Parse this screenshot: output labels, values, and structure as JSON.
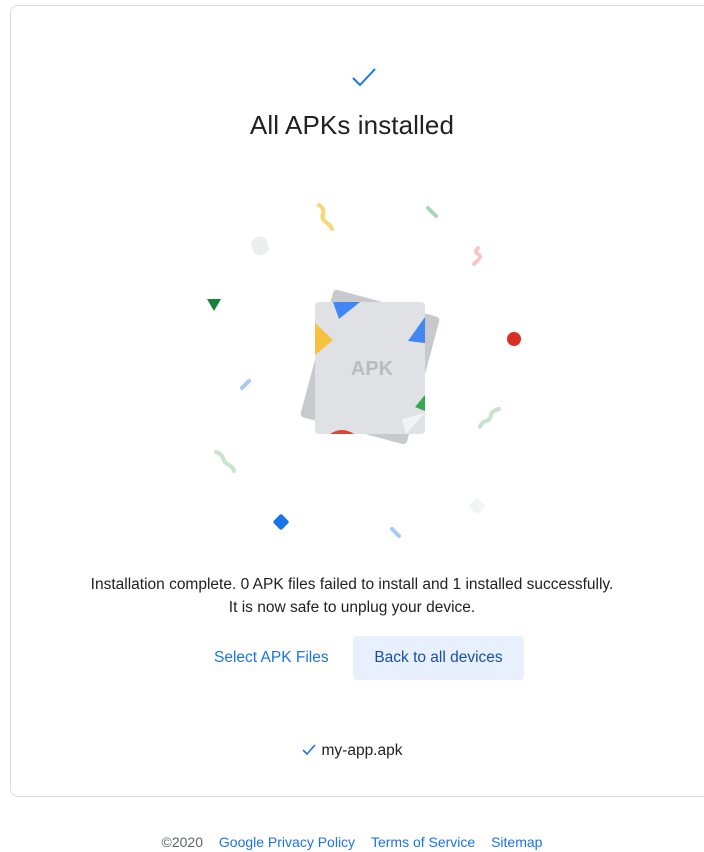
{
  "status": {
    "icon": "check-icon",
    "title": "All APKs installed"
  },
  "illustration": {
    "file_label": "APK",
    "colors": {
      "blue": "#4285f4",
      "red": "#db4437",
      "yellow": "#f4b400",
      "green": "#0f9d58",
      "gray": "#dadce0"
    }
  },
  "message": {
    "line1": "Installation complete. 0 APK files failed to install and 1 installed successfully.",
    "line2": "It is now safe to unplug your device."
  },
  "actions": {
    "select_label": "Select APK Files",
    "back_label": "Back to all devices"
  },
  "files": [
    {
      "icon": "check-icon",
      "name": "my-app.apk"
    }
  ],
  "footer": {
    "copyright": "©2020",
    "links": [
      "Google Privacy Policy",
      "Terms of Service",
      "Sitemap"
    ]
  },
  "accent_color": "#1a73e8"
}
